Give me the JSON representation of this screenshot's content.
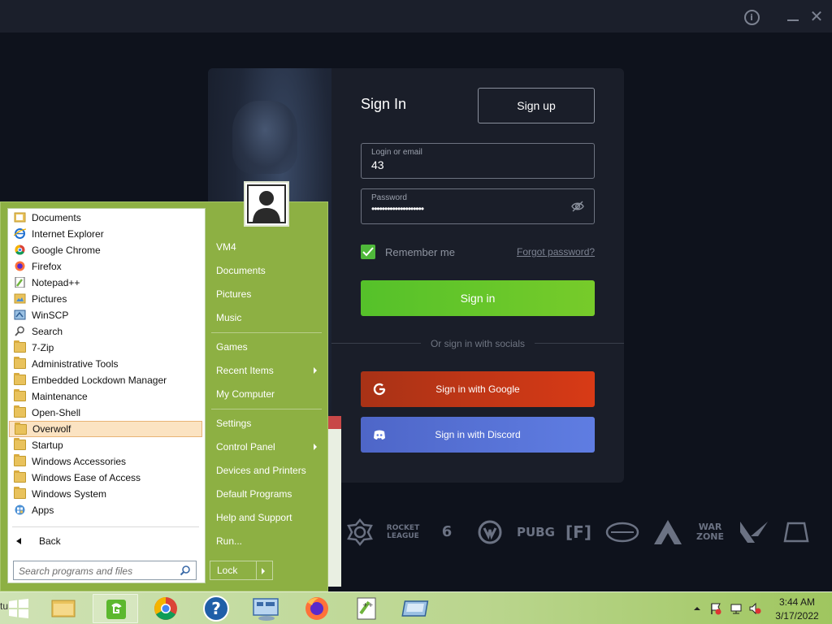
{
  "overwolf": {
    "sign_in_title": "Sign In",
    "sign_up_label": "Sign up",
    "login_label": "Login or email",
    "login_value": "43",
    "password_label": "Password",
    "password_value": "••••••••••••••••••••",
    "remember_label": "Remember me",
    "remember_checked": true,
    "forgot_label": "Forgot password?",
    "sign_in_button": "Sign in",
    "or_socials": "Or sign in with socials",
    "google_button": "Sign in with Google",
    "discord_button": "Sign in with Discord",
    "games": [
      {
        "name": "Hearthstone",
        "label": ""
      },
      {
        "name": "Rocket League",
        "label": "ROCKET\nLEAGUE"
      },
      {
        "name": "Rainbow Six",
        "label": "6"
      },
      {
        "name": "Overwatch",
        "label": ""
      },
      {
        "name": "PUBG",
        "label": "PUBG"
      },
      {
        "name": "Escape from Tarkov",
        "label": "[F]"
      },
      {
        "name": "Splitgate",
        "label": ""
      },
      {
        "name": "Apex Legends",
        "label": ""
      },
      {
        "name": "Warzone",
        "label": "WAR\nZONE"
      },
      {
        "name": "Valorant",
        "label": ""
      },
      {
        "name": "Fortnite",
        "label": ""
      }
    ],
    "colors": {
      "accent_green": "#77cb2a",
      "google_red": "#d83a16",
      "discord_blue": "#5f7de2"
    }
  },
  "start_menu": {
    "programs": [
      {
        "label": "Documents",
        "icon": "documents-icon"
      },
      {
        "label": "Internet Explorer",
        "icon": "internet-explorer-icon"
      },
      {
        "label": "Google Chrome",
        "icon": "chrome-icon"
      },
      {
        "label": "Firefox",
        "icon": "firefox-icon"
      },
      {
        "label": "Notepad++",
        "icon": "notepad-plus-icon"
      },
      {
        "label": "Pictures",
        "icon": "pictures-icon"
      },
      {
        "label": "WinSCP",
        "icon": "winscp-icon"
      },
      {
        "label": "Search",
        "icon": "search-icon"
      },
      {
        "label": "7-Zip",
        "icon": "folder-icon"
      },
      {
        "label": "Administrative Tools",
        "icon": "folder-icon"
      },
      {
        "label": "Embedded Lockdown Manager",
        "icon": "folder-icon"
      },
      {
        "label": "Maintenance",
        "icon": "folder-icon"
      },
      {
        "label": "Open-Shell",
        "icon": "folder-icon"
      },
      {
        "label": "Overwolf",
        "icon": "folder-icon",
        "highlighted": true
      },
      {
        "label": "Startup",
        "icon": "folder-icon"
      },
      {
        "label": "Windows Accessories",
        "icon": "folder-icon"
      },
      {
        "label": "Windows Ease of Access",
        "icon": "folder-icon"
      },
      {
        "label": "Windows System",
        "icon": "folder-icon"
      },
      {
        "label": "Apps",
        "icon": "apps-icon"
      }
    ],
    "back_label": "Back",
    "search_placeholder": "Search programs and files",
    "right_items": [
      {
        "label": "VM4",
        "submenu": false
      },
      {
        "label": "Documents",
        "submenu": false
      },
      {
        "label": "Pictures",
        "submenu": false
      },
      {
        "label": "Music",
        "submenu": false
      },
      {
        "label": "Games",
        "submenu": false
      },
      {
        "label": "Recent Items",
        "submenu": true
      },
      {
        "label": "My Computer",
        "submenu": false
      },
      {
        "label": "Settings",
        "submenu": false
      },
      {
        "label": "Control Panel",
        "submenu": true
      },
      {
        "label": "Devices and Printers",
        "submenu": false
      },
      {
        "label": "Default Programs",
        "submenu": false
      },
      {
        "label": "Help and Support",
        "submenu": false
      },
      {
        "label": "Run...",
        "submenu": false
      }
    ],
    "lock_label": "Lock"
  },
  "taskbar": {
    "start_label": "tu",
    "pinned": [
      "file-explorer-icon",
      "overwolf-icon",
      "chrome-icon",
      "help-icon",
      "remote-desktop-icon",
      "firefox-icon",
      "notepad-plus-icon",
      "virtual-machine-icon"
    ],
    "clock_time": "3:44 AM",
    "clock_date": "3/17/2022"
  }
}
